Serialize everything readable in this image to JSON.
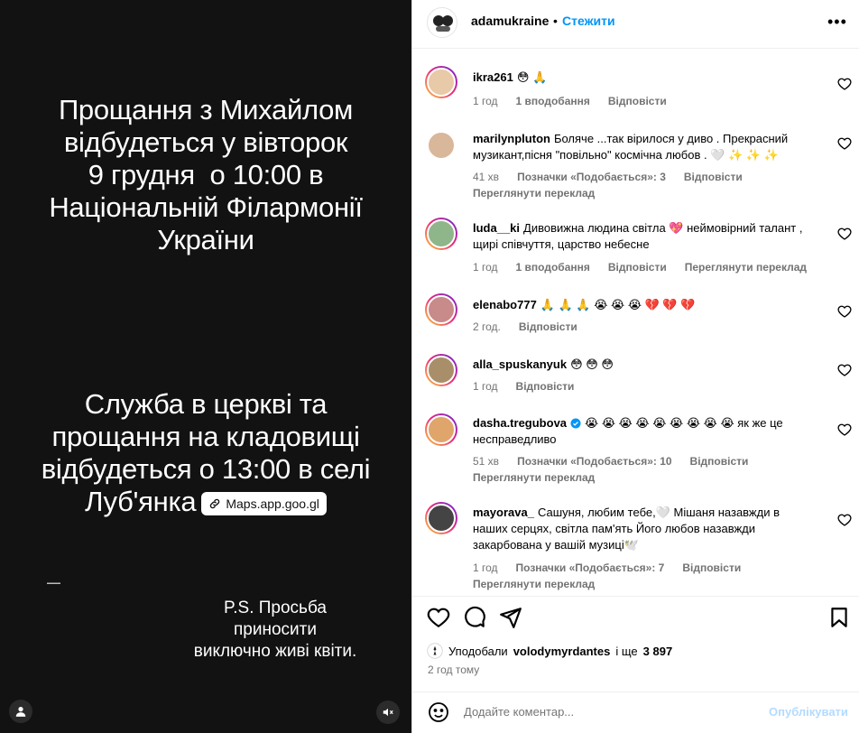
{
  "media": {
    "block1": [
      "Прощання з Михайлом",
      "відбудеться у вівторок",
      "9 грудня  о 10:00 в",
      "Національній Філармонії",
      "України"
    ],
    "block2": [
      "Служба в церкві та",
      "прощання на кладовищі",
      "відбудеться о 13:00 в селі"
    ],
    "block2_last": "Луб'янка",
    "maps_chip": "Maps.app.goo.gl",
    "ps": [
      "P.S. Просьба приносити",
      "виключно живі квіти."
    ]
  },
  "header": {
    "username": "adamukraine",
    "separator": "•",
    "follow": "Стежити",
    "more": "•••"
  },
  "comments": [
    {
      "user": "ikra261",
      "text": "😳 🙏",
      "meta": [
        "1 год",
        "1 вподобання",
        "Відповісти"
      ],
      "translate": ""
    },
    {
      "user": "marilynpluton",
      "text": "Боляче ...так вірилося у диво . Прекрасний музикант,пісня \"повільно\" космічна любов . 🤍 ✨ ✨ ✨",
      "meta": [
        "41 хв",
        "Позначки «Подобається»: 3",
        "Відповісти"
      ],
      "translate": "Переглянути переклад"
    },
    {
      "user": "luda__ki",
      "text": "Дивовижна людина світла 💖 неймовірний талант , щирі співчуття, царство небесне",
      "meta": [
        "1 год",
        "1 вподобання",
        "Відповісти",
        "Переглянути переклад"
      ],
      "translate": ""
    },
    {
      "user": "elenabo777",
      "text": "🙏 🙏 🙏 😭 😭 😭 💔 💔 💔",
      "meta": [
        "2 год.",
        "Відповісти"
      ],
      "translate": ""
    },
    {
      "user": "alla_spuskanyuk",
      "text": "😳 😳 😳",
      "meta": [
        "1 год",
        "Відповісти"
      ],
      "translate": ""
    },
    {
      "user": "dasha.tregubova",
      "text": "😭 😭 😭 😭 😭 😭 😭 😭 😭 як же це несправедливо",
      "meta": [
        "51 хв",
        "Позначки «Подобається»: 10",
        "Відповісти"
      ],
      "translate": "Переглянути переклад"
    },
    {
      "user": "mayorava_",
      "text": "Сашуня, любим тебе,🤍  Мішаня назавжди в наших серцях, світла пам'ять Його любов назавжди закарбована у вашій музиці🕊️",
      "meta": [
        "1 год",
        "Позначки «Подобається»: 7",
        "Відповісти"
      ],
      "translate": "Переглянути переклад"
    }
  ],
  "likes": {
    "prefix": "Уподобали",
    "user": "volodymyrdantes",
    "suffix": "і ще",
    "count": "3 897"
  },
  "time": "2 год тому",
  "add_comment": {
    "placeholder": "Додайте коментар...",
    "post": "Опублікувати"
  }
}
